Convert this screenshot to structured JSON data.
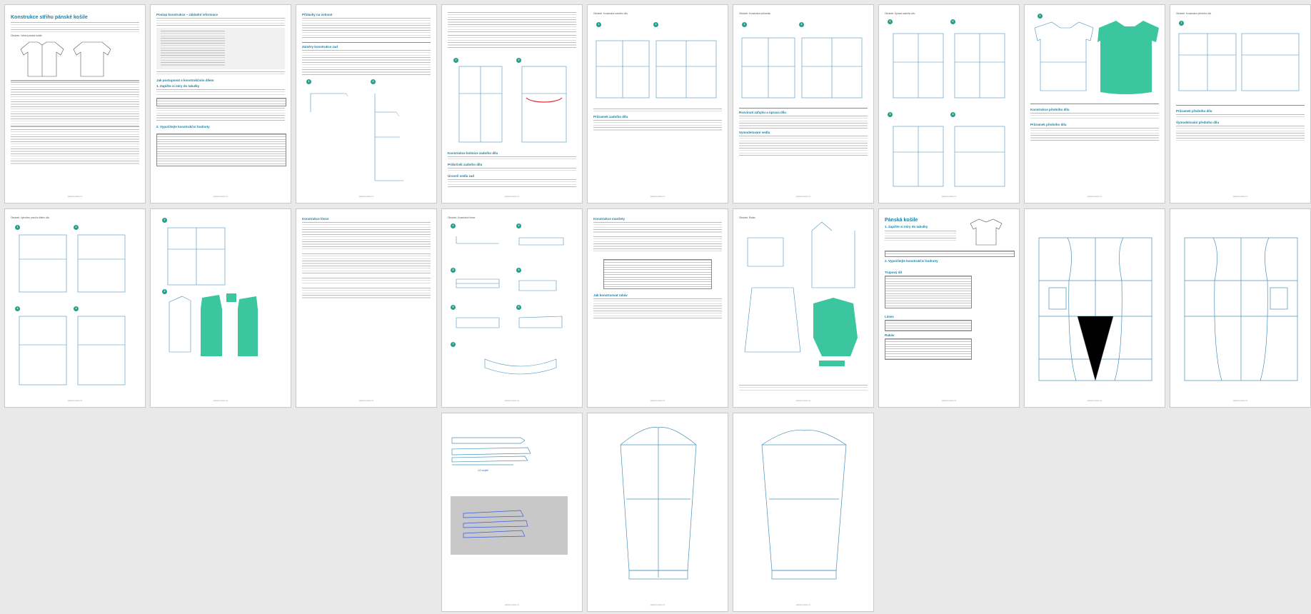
{
  "colors": {
    "accent": "#1f7fa3",
    "fill": "#3bc6a0",
    "marker": "#1fa18b",
    "line": "#4a90b8"
  },
  "footer": "patterncutter.cz",
  "pages": {
    "p1": {
      "title": "Konstrukce střihu pánské košile",
      "caption": "Obrázek: Vzhled pánské košile"
    },
    "p2": {
      "heading": "Postup konstrukce – základní informace",
      "sub1": "Jak postupovat s konstrukčním dílem",
      "sub2": "1. Zapište si míry do tabulky",
      "sub3": "2. Vypočítejte konstrukční hodnoty"
    },
    "p3": {
      "heading": "Přídavky na volnost",
      "sub1": "Záměry konstrukce zad"
    },
    "p4": {
      "sub1": "Konstrukce kolmice zadního dílu",
      "sub2": "Průkrčník zadního dílu",
      "sub3": "Úroveň sedla zad"
    },
    "p5": {
      "caption": "Obrázek: Konstrukce zadního dílu",
      "sub1": "Průramek zadního dílu"
    },
    "p6": {
      "caption": "Obrázek: Konstrukce průramku",
      "sub1": "Rozvinutí záhybu a úprava dílu",
      "sub2": "Vymodelování sedla"
    },
    "p7": {
      "caption": "Obrázek: Úprava zadního dílu"
    },
    "p9": {
      "caption": "Obrázek: Konstrukce předního dílu",
      "sub1": "Konstrukce předního dílu",
      "sub2": "Průramek předního dílu",
      "sub3": "Vymodelování předního dílu"
    },
    "p10": {
      "caption": "Obrázek: Vytvoření prsního šitého dílu"
    },
    "p12": {
      "heading": "Konstrukce límce"
    },
    "p13": {
      "caption": "Obrázek: Konstrukce límce"
    },
    "p14": {
      "heading": "Konstrukce manžety",
      "sub1": "Jak konstruovat rukáv"
    },
    "p15": {
      "caption": "Obrázek: Rukáv"
    },
    "p16": {
      "title": "Pánská košile",
      "sub1": "1. Zapište si míry do tabulky",
      "sub2": "2. Vypočítejte konstrukční hodnoty",
      "sub3": "Trupový díl",
      "sub4": "Límec",
      "sub5": "Rukáv"
    },
    "p19": {
      "label": "1/2 rozpětí"
    }
  }
}
